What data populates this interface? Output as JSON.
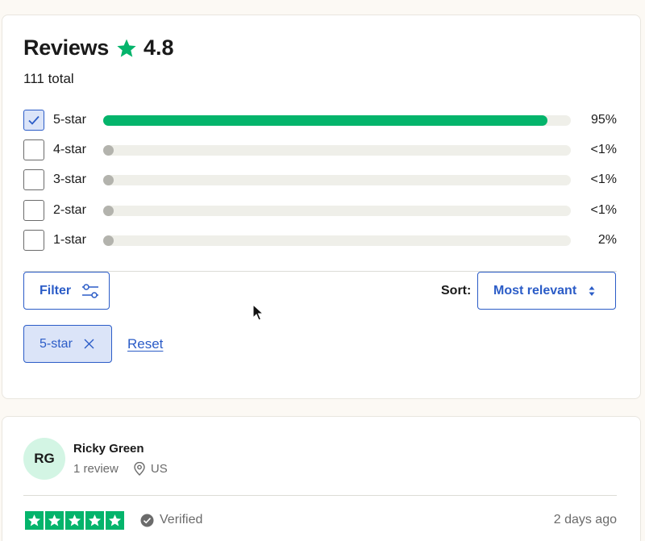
{
  "header": {
    "title": "Reviews",
    "rating": "4.8",
    "total": "111 total"
  },
  "distribution": [
    {
      "label": "5-star",
      "percent": "95%",
      "fill": 0.95,
      "checked": true
    },
    {
      "label": "4-star",
      "percent": "<1%",
      "fill": 0.0,
      "checked": false
    },
    {
      "label": "3-star",
      "percent": "<1%",
      "fill": 0.0,
      "checked": false
    },
    {
      "label": "2-star",
      "percent": "<1%",
      "fill": 0.0,
      "checked": false
    },
    {
      "label": "1-star",
      "percent": "2%",
      "fill": 0.0,
      "checked": false
    }
  ],
  "controls": {
    "filter_label": "Filter",
    "sort_label": "Sort:",
    "sort_value": "Most relevant",
    "active_filter": "5-star",
    "reset_label": "Reset"
  },
  "review": {
    "initials": "RG",
    "name": "Ricky Green",
    "review_count": "1 review",
    "country": "US",
    "stars": 5,
    "verified_label": "Verified",
    "date": "2 days ago"
  },
  "colors": {
    "accent_green": "#04b46b",
    "link_blue": "#2b5cc7",
    "chip_bg": "#dbe4f8",
    "avatar_bg": "#d3f5e4"
  },
  "icons": [
    "star-icon",
    "checkmark-icon",
    "filter-sliders-icon",
    "sort-arrows-icon",
    "close-icon",
    "location-pin-icon",
    "verified-check-icon",
    "cursor-icon"
  ]
}
